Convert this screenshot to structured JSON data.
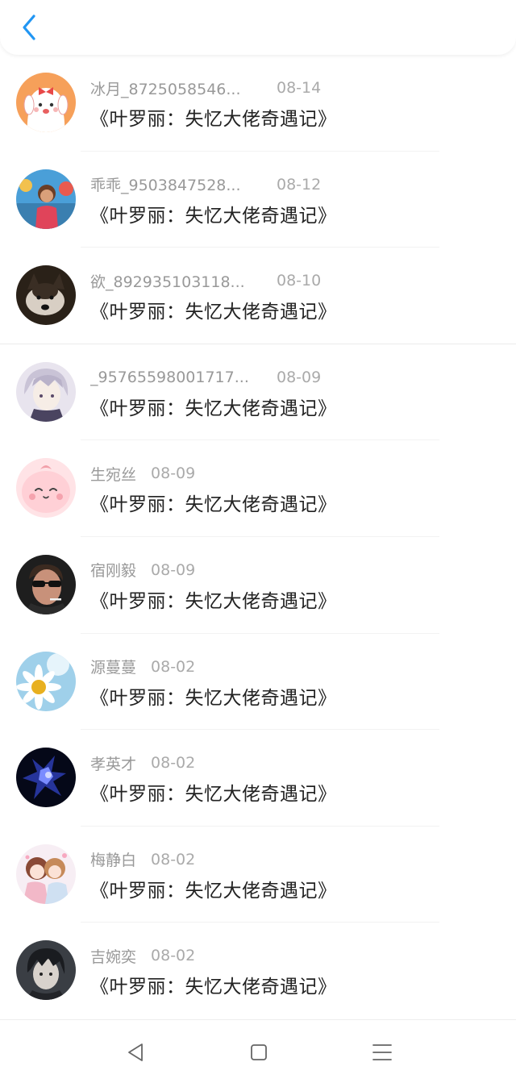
{
  "header": {
    "back_icon": "chevron-left-icon",
    "accent_color": "#2196f3"
  },
  "items": [
    {
      "name": "冰月_8725058546...",
      "date": "08-14",
      "title": "《叶罗丽：失忆大佬奇遇记》",
      "avatar": "cartoon-bunny-avatar"
    },
    {
      "name": "乖乖_9503847528...",
      "date": "08-12",
      "title": "《叶罗丽：失忆大佬奇遇记》",
      "avatar": "child-photo-avatar"
    },
    {
      "name": "欲_892935103118...",
      "date": "08-10",
      "title": "《叶罗丽：失忆大佬奇遇记》",
      "avatar": "husky-dog-avatar"
    },
    {
      "name": "_95765598001717...",
      "date": "08-09",
      "title": "《叶罗丽：失忆大佬奇遇记》",
      "avatar": "anime-boy-avatar"
    },
    {
      "name": "生宛丝",
      "date": "08-09",
      "title": "《叶罗丽：失忆大佬奇遇记》",
      "avatar": "pink-blob-avatar"
    },
    {
      "name": "宿刚毅",
      "date": "08-09",
      "title": "《叶罗丽：失忆大佬奇遇记》",
      "avatar": "man-sunglasses-avatar"
    },
    {
      "name": "源蔓蔓",
      "date": "08-02",
      "title": "《叶罗丽：失忆大佬奇遇记》",
      "avatar": "daisy-flower-avatar"
    },
    {
      "name": "孝英才",
      "date": "08-02",
      "title": "《叶罗丽：失忆大佬奇遇记》",
      "avatar": "dark-blue-avatar"
    },
    {
      "name": "梅静白",
      "date": "08-02",
      "title": "《叶罗丽：失忆大佬奇遇记》",
      "avatar": "anime-couple-avatar"
    },
    {
      "name": "吉婉奕",
      "date": "08-02",
      "title": "《叶罗丽：失忆大佬奇遇记》",
      "avatar": "dark-hair-boy-avatar"
    }
  ],
  "navbar": {
    "icons": [
      "back-triangle-icon",
      "home-square-icon",
      "menu-lines-icon"
    ]
  }
}
